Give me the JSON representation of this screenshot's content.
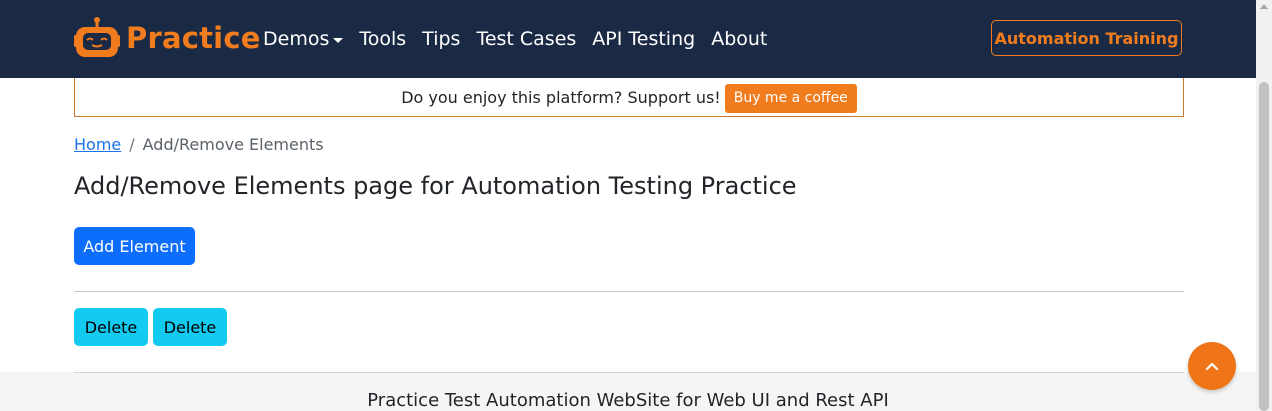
{
  "navbar": {
    "brand": "Practice",
    "links": [
      {
        "label": "Demos",
        "dropdown": true
      },
      {
        "label": "Tools"
      },
      {
        "label": "Tips"
      },
      {
        "label": "Test Cases"
      },
      {
        "label": "API Testing"
      },
      {
        "label": "About"
      }
    ],
    "cta_label": "Automation Training"
  },
  "support": {
    "text": "Do you enjoy this platform? Support us!",
    "button_label": "Buy me a coffee"
  },
  "breadcrumb": {
    "home": "Home",
    "separator": "/",
    "current": "Add/Remove Elements"
  },
  "main": {
    "title": "Add/Remove Elements page for Automation Testing Practice",
    "add_label": "Add Element",
    "delete_buttons": [
      "Delete",
      "Delete"
    ]
  },
  "footer": {
    "text": "Practice Test Automation WebSite for Web UI and Rest API"
  },
  "icons": {
    "back_to_top": "chevron-up-icon",
    "logo": "robot-logo-icon"
  },
  "colors": {
    "navbar_bg": "#1b2a44",
    "accent": "#f07c1e",
    "primary": "#0d6efd",
    "info": "#13caf0"
  }
}
